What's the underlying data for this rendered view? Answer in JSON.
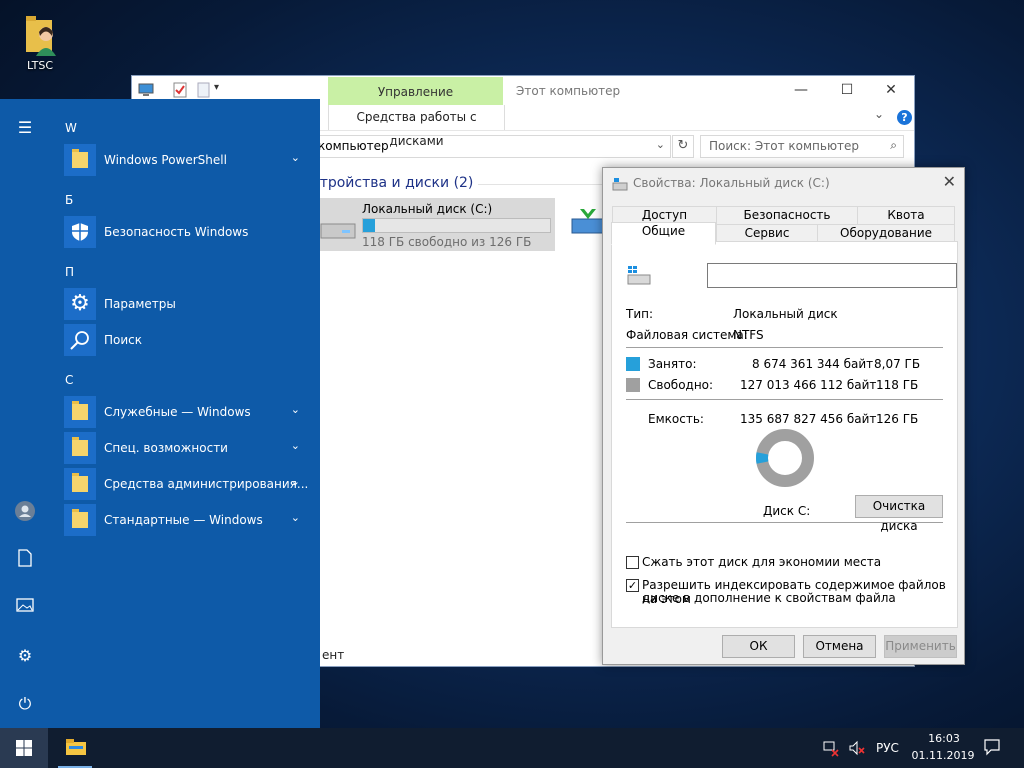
{
  "desktop": {
    "icon_label": "LTSC"
  },
  "explorer": {
    "window_title": "Этот компьютер",
    "context_tab": "Управление",
    "ribbon_tab": "Средства работы с дисками",
    "address": "компьютер",
    "search_placeholder": "Поиск: Этот компьютер",
    "group_header": "стройства и диски (2)",
    "disk": {
      "name": "Локальный диск (C:)",
      "free_text": "118 ГБ свободно из 126 ГБ",
      "used_fraction": 0.064
    },
    "status_text": "ент",
    "window_buttons": {
      "minimize": "—",
      "maximize": "☐",
      "close": "✕"
    }
  },
  "start_menu": {
    "letters": [
      "W",
      "Б",
      "П",
      "С"
    ],
    "apps": [
      {
        "name": "Windows PowerShell",
        "expandable": true,
        "icon": "folder-icon"
      },
      {
        "name": "Безопасность Windows",
        "expandable": false,
        "icon": "shield-icon"
      },
      {
        "name": "Параметры",
        "expandable": false,
        "icon": "gear-icon"
      },
      {
        "name": "Поиск",
        "expandable": false,
        "icon": "search-icon"
      },
      {
        "name": "Служебные — Windows",
        "expandable": true,
        "icon": "folder-icon"
      },
      {
        "name": "Спец. возможности",
        "expandable": true,
        "icon": "folder-icon"
      },
      {
        "name": "Средства администрирования...",
        "expandable": true,
        "icon": "folder-icon"
      },
      {
        "name": "Стандартные — Windows",
        "expandable": true,
        "icon": "folder-icon"
      }
    ],
    "rail_icons": [
      "hamburger-icon",
      "user-icon",
      "document-icon",
      "pictures-icon",
      "settings-icon",
      "power-icon"
    ]
  },
  "properties": {
    "title": "Свойства: Локальный диск (C:)",
    "tabs_row1": [
      "Доступ",
      "Безопасность",
      "Квота"
    ],
    "tabs_row2": [
      "Общие",
      "Сервис",
      "Оборудование"
    ],
    "active_tab": "Общие",
    "name_value": "",
    "type_label": "Тип:",
    "type_value": "Локальный диск",
    "fs_label": "Файловая система:",
    "fs_value": "NTFS",
    "used_label": "Занято:",
    "used_bytes": "8 674 361 344 байт",
    "used_size": "8,07 ГБ",
    "free_label": "Свободно:",
    "free_bytes": "127 013 466 112 байт",
    "free_size": "118 ГБ",
    "capacity_label": "Емкость:",
    "capacity_bytes": "135 687 827 456 байт",
    "capacity_size": "126 ГБ",
    "disk_label": "Диск C:",
    "cleanup_button": "Очистка диска",
    "compress_label": "Сжать этот диск для экономии места",
    "compress_checked": false,
    "index_label_line1": "Разрешить индексировать содержимое файлов на этом",
    "index_label_line2": "диске в дополнение к свойствам файла",
    "index_checked": true,
    "ok": "ОК",
    "cancel": "Отмена",
    "apply": "Применить",
    "used_fraction": 0.064,
    "used_color": "#26a0da",
    "free_color": "#a0a0a0"
  },
  "taskbar": {
    "language": "РУС",
    "time": "16:03",
    "date": "01.11.2019"
  }
}
